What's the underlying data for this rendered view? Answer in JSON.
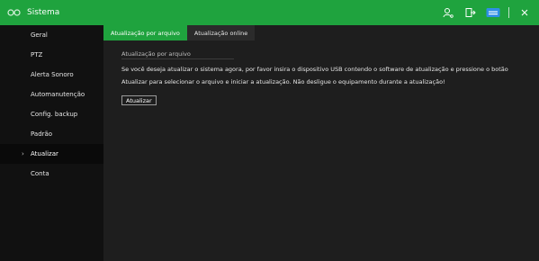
{
  "window": {
    "title": "Sistema"
  },
  "header_icons": [
    "user-icon",
    "logout-icon",
    "monitor-icon",
    "close-icon"
  ],
  "sidebar": {
    "items": [
      {
        "label": "Geral"
      },
      {
        "label": "PTZ"
      },
      {
        "label": "Alerta Sonoro"
      },
      {
        "label": "Automanutenção"
      },
      {
        "label": "Config. backup"
      },
      {
        "label": "Padrão"
      },
      {
        "label": "Atualizar",
        "active": true
      },
      {
        "label": "Conta"
      }
    ]
  },
  "tabs": [
    {
      "label": "Atualização por arquivo",
      "active": true
    },
    {
      "label": "Atualização online"
    }
  ],
  "content": {
    "section_title": "Atualização por arquivo",
    "description": "Se você deseja atualizar o sistema agora, por favor insira o dispositivo USB contendo o software de atualização e pressione o botão Atualizar para selecionar o arquivo e iniciar a atualização. Não desligue o equipamento durante a atualização!",
    "update_button": "Atualizar"
  },
  "colors": {
    "accent": "#1fa33e",
    "background": "#1e1e1e",
    "sidebar": "#111111"
  }
}
